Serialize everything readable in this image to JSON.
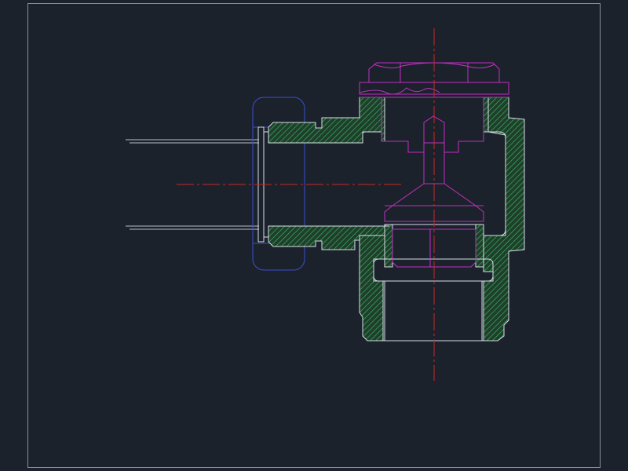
{
  "drawing": {
    "background": "#1c222c",
    "colors": {
      "frame": "#8a9099",
      "outline": "#d8dde6",
      "hatch_fill": "#1f3f2c",
      "hatch_line": "#3fbf66",
      "magenta": "#c22fc2",
      "center_line": "#c8262a",
      "blue": "#3a4fd0",
      "pipe": "#b8bec8"
    },
    "icons": [
      "hatch-pattern",
      "center-line-dashdot"
    ]
  }
}
